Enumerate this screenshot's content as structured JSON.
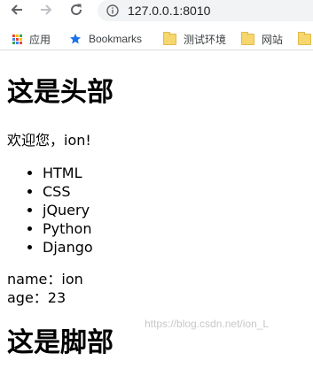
{
  "browser": {
    "url": "127.0.0.1:8010",
    "bookmarks": [
      {
        "label": "应用",
        "icon": "apps-grid-icon"
      },
      {
        "label": "Bookmarks",
        "icon": "star-icon"
      },
      {
        "label": "测试环境",
        "icon": "folder-icon"
      },
      {
        "label": "网站",
        "icon": "folder-icon"
      }
    ]
  },
  "page": {
    "header": "这是头部",
    "welcome": "欢迎您，ion!",
    "skills": [
      "HTML",
      "CSS",
      "jQuery",
      "Python",
      "Django"
    ],
    "name_line": "name：ion",
    "age_line": "age：23",
    "footer": "这是脚部"
  },
  "watermark": "https://blog.csdn.net/ion_L",
  "colors": {
    "icon_gray": "#5f6368",
    "star_blue": "#1a73e8",
    "folder_yellow": "#f5d76e"
  }
}
